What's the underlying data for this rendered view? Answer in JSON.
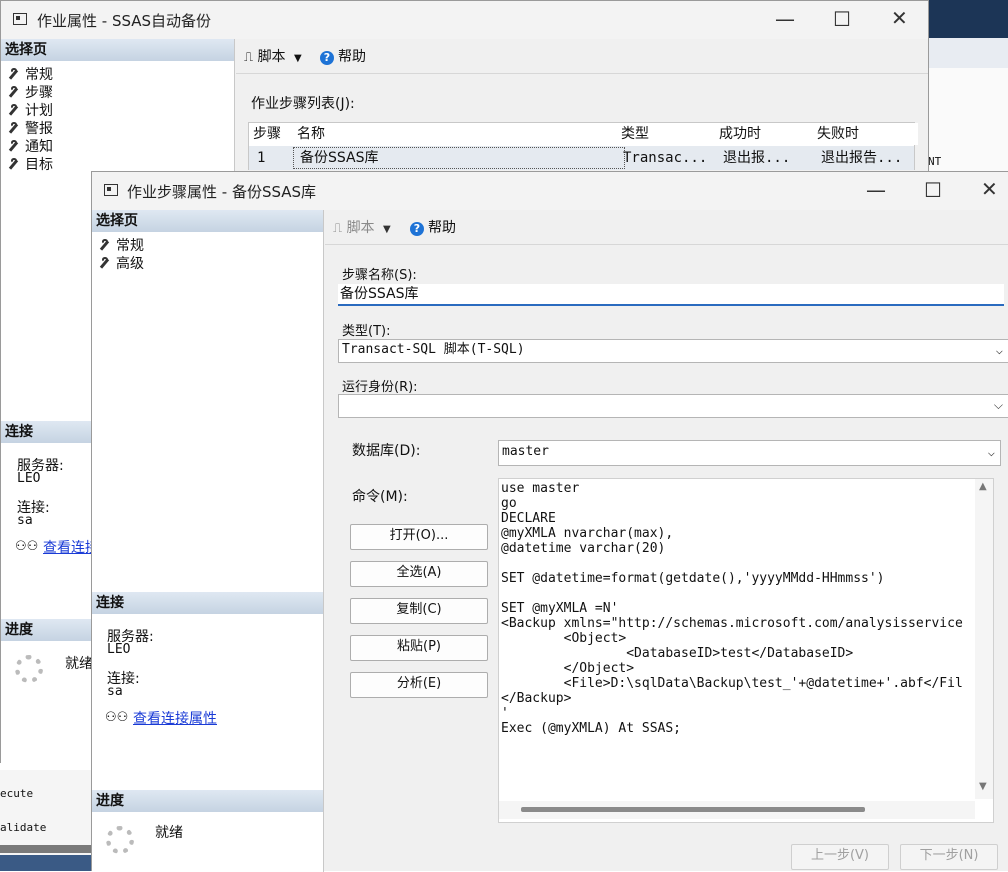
{
  "bg": {
    "right_frag": "NT",
    "left_frag_1": "ecute",
    "left_frag_2": "alidate"
  },
  "job_window": {
    "title": "作业属性 - SSAS自动备份",
    "select_page_header": "选择页",
    "nav": [
      "常规",
      "步骤",
      "计划",
      "警报",
      "通知",
      "目标"
    ],
    "toolbar": {
      "script": "脚本",
      "help": "帮助"
    },
    "steps_list_label": "作业步骤列表(J):",
    "columns": [
      "步骤",
      "名称",
      "类型",
      "成功时",
      "失败时"
    ],
    "row": [
      "1",
      "备份SSAS库",
      "Transac...",
      "退出报...",
      "退出报告..."
    ],
    "connection_header": "连接",
    "server_label": "服务器:",
    "server_value": "LEO",
    "connection_label": "连接:",
    "connection_value": "sa",
    "view_connection_link": "查看连接",
    "progress_header": "进度",
    "progress_status": "就绪"
  },
  "step_dialog": {
    "title": "作业步骤属性 - 备份SSAS库",
    "select_page_header": "选择页",
    "nav": [
      "常规",
      "高级"
    ],
    "toolbar": {
      "script": "脚本",
      "help": "帮助"
    },
    "step_name_label": "步骤名称(S):",
    "step_name_value": "备份SSAS库",
    "type_label": "类型(T):",
    "type_value": "Transact-SQL 脚本(T-SQL)",
    "run_as_label": "运行身份(R):",
    "run_as_value": "",
    "database_label": "数据库(D):",
    "database_value": "master",
    "command_label": "命令(M):",
    "buttons": {
      "open": "打开(O)...",
      "select_all": "全选(A)",
      "copy": "复制(C)",
      "paste": "粘贴(P)",
      "parse": "分析(E)"
    },
    "command_lines": [
      "use master",
      "go",
      "DECLARE",
      "@myXMLA nvarchar(max),",
      "@datetime varchar(20)",
      "",
      "SET @datetime=format(getdate(),'yyyyMMdd-HHmmss')",
      "",
      "SET @myXMLA =N'",
      "<Backup xmlns=\"http://schemas.microsoft.com/analysisservice",
      "        <Object>",
      "                <DatabaseID>test</DatabaseID>",
      "        </Object>",
      "        <File>D:\\sqlData\\Backup\\test_'+@datetime+'.abf</Fil",
      "</Backup>",
      "'",
      "Exec (@myXMLA) At SSAS;"
    ],
    "connection_header": "连接",
    "server_label": "服务器:",
    "server_value": "LEO",
    "connection_label": "连接:",
    "connection_value": "sa",
    "view_connection_link": "查看连接属性",
    "progress_header": "进度",
    "progress_status": "就绪",
    "prev_button": "上一步(V)",
    "next_button": "下一步(N)"
  },
  "icons": {
    "nav": "wrench-icon",
    "script": "script-icon",
    "help": "help-icon",
    "connection": "connection-icon",
    "progress": "spinner-icon",
    "minimize": "minimize-icon",
    "maximize": "maximize-icon",
    "close": "close-icon",
    "dropdown": "chevron-down-icon"
  },
  "colors": {
    "section_header": "#c5d3e2",
    "link": "#1a3bd6",
    "help_icon": "#1e73d6",
    "focus_underline": "#2a6bbf"
  }
}
